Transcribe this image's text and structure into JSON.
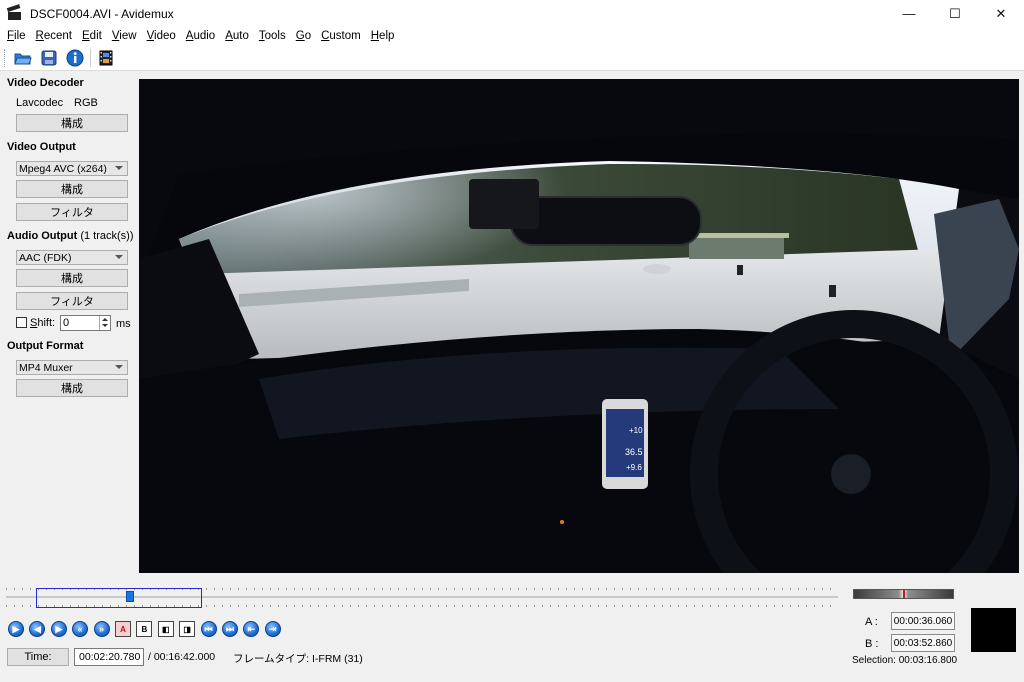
{
  "window": {
    "title": "DSCF0004.AVI - Avidemux",
    "minimize": "—",
    "maximize": "☐",
    "close": "✕"
  },
  "menu": [
    {
      "key": "F",
      "rest": "ile"
    },
    {
      "key": "R",
      "rest": "ecent"
    },
    {
      "key": "E",
      "rest": "dit"
    },
    {
      "key": "V",
      "rest": "iew"
    },
    {
      "key": "V",
      "rest": "ideo"
    },
    {
      "key": "A",
      "rest": "udio"
    },
    {
      "key": "A",
      "rest": "uto"
    },
    {
      "key": "T",
      "rest": "ools"
    },
    {
      "key": "G",
      "rest": "o"
    },
    {
      "key": "C",
      "rest": "ustom"
    },
    {
      "key": "H",
      "rest": "elp"
    }
  ],
  "toolbar": {
    "icons": [
      "open-folder-icon",
      "save-disk-icon",
      "info-icon",
      "film-properties-icon"
    ]
  },
  "video_decoder": {
    "title": "Video Decoder",
    "codec": "Lavcodec",
    "format": "RGB",
    "configure": "構成"
  },
  "video_output": {
    "title": "Video Output",
    "codec": "Mpeg4 AVC (x264)",
    "configure": "構成",
    "filters": "フィルタ"
  },
  "audio_output": {
    "title": "Audio Output",
    "tracks": "(1 track(s))",
    "codec": "AAC (FDK)",
    "configure": "構成",
    "filters": "フィルタ",
    "shift_key": "S",
    "shift_rest": "hift:",
    "shift_value": "0",
    "shift_unit": "ms"
  },
  "output_format": {
    "title": "Output Format",
    "muxer": "MP4 Muxer",
    "configure": "構成"
  },
  "slider": {
    "position": 0.144,
    "selection_start": 0.036,
    "selection_end": 0.236
  },
  "phone_overlay": {
    "v1": "+10",
    "v2": "36.5",
    "v3": "+9.6"
  },
  "navigation": {
    "buttons": [
      {
        "name": "play-button",
        "glyph": "▶",
        "type": "round"
      },
      {
        "name": "previous-frame-button",
        "glyph": "◀",
        "type": "round"
      },
      {
        "name": "next-frame-button",
        "glyph": "▶",
        "type": "round"
      },
      {
        "name": "previous-keyframe-button",
        "glyph": "«",
        "type": "round"
      },
      {
        "name": "next-keyframe-button",
        "glyph": "»",
        "type": "round"
      },
      {
        "name": "set-marker-a-button",
        "glyph": "A",
        "type": "square"
      },
      {
        "name": "set-marker-b-button",
        "glyph": "B",
        "type": "square"
      },
      {
        "name": "go-to-marker-a-button",
        "glyph": "◧",
        "type": "square"
      },
      {
        "name": "go-to-marker-b-button",
        "glyph": "◨",
        "type": "square"
      },
      {
        "name": "previous-black-frame-button",
        "glyph": "⏮",
        "type": "round"
      },
      {
        "name": "next-black-frame-button",
        "glyph": "⏭",
        "type": "round"
      },
      {
        "name": "go-to-first-frame-button",
        "glyph": "⇤",
        "type": "round"
      },
      {
        "name": "go-to-last-frame-button",
        "glyph": "⇥",
        "type": "round"
      }
    ]
  },
  "time": {
    "label": "Time:",
    "current": "00:02:20.780",
    "total": "/ 00:16:42.000",
    "frame_type": "フレームタイプ: I-FRM (31)"
  },
  "markers": {
    "a_label": "A :",
    "a_value": "00:00:36.060",
    "b_label": "B :",
    "b_value": "00:03:52.860",
    "selection": "Selection: 00:03:16.800"
  },
  "colors": {
    "accent": "#1874e0",
    "selection_border": "#2a2ad0",
    "video_bg": "#05070c"
  }
}
